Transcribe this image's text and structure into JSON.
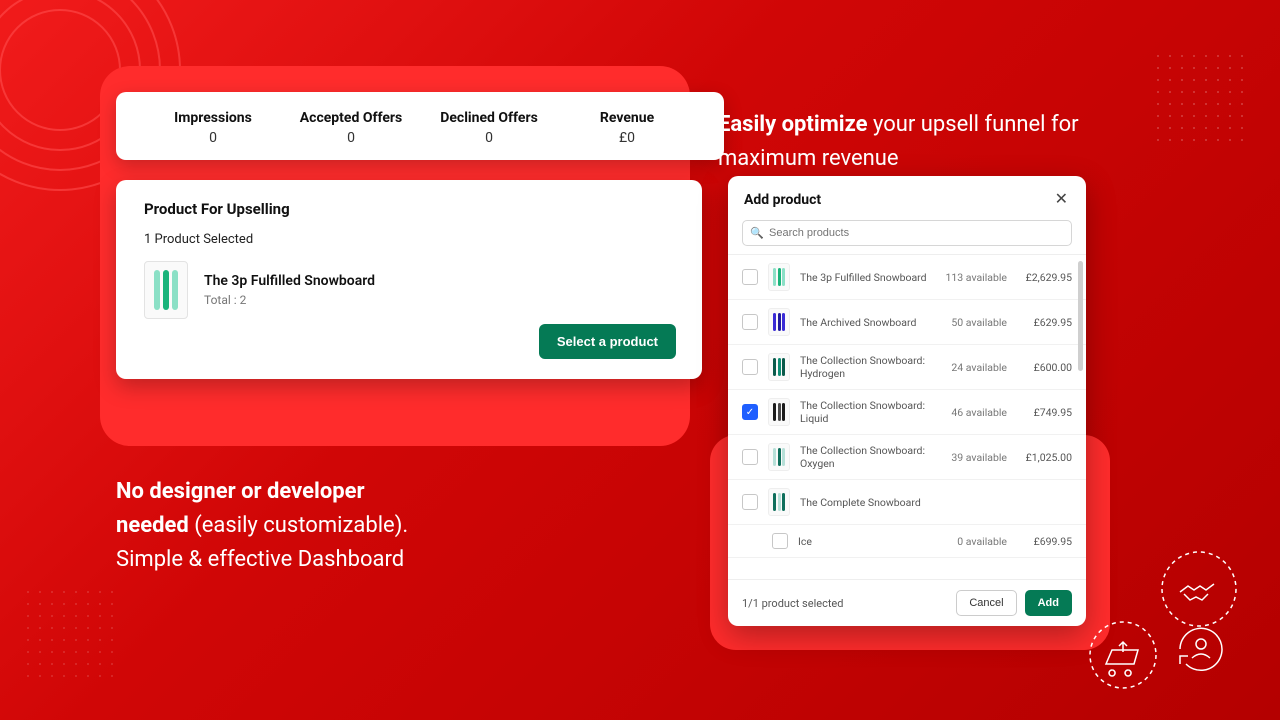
{
  "stats": {
    "impressions": {
      "label": "Impressions",
      "value": "0"
    },
    "accepted": {
      "label": "Accepted Offers",
      "value": "0"
    },
    "declined": {
      "label": "Declined Offers",
      "value": "0"
    },
    "revenue": {
      "label": "Revenue",
      "value": "£0"
    }
  },
  "upsell": {
    "heading": "Product For Upselling",
    "selected_summary": "1 Product Selected",
    "product": {
      "name": "The 3p Fulfilled Snowboard",
      "total": "Total : 2"
    },
    "select_button": "Select a product"
  },
  "left_caption": {
    "bold1": "No designer or developer",
    "bold2": "needed",
    "rest1": " (easily customizable).",
    "line2": "Simple & effective Dashboard"
  },
  "right_caption": {
    "bold": "Easily optimize",
    "rest": " your upsell funnel for maximum revenue"
  },
  "modal": {
    "title": "Add product",
    "search_placeholder": "Search products",
    "rows": [
      {
        "name": "The 3p Fulfilled Snowboard",
        "avail": "113 available",
        "price": "£2,629.95",
        "selected": false
      },
      {
        "name": "The Archived Snowboard",
        "avail": "50 available",
        "price": "£629.95",
        "selected": false
      },
      {
        "name": "The Collection Snowboard: Hydrogen",
        "avail": "24 available",
        "price": "£600.00",
        "selected": false
      },
      {
        "name": "The Collection Snowboard: Liquid",
        "avail": "46 available",
        "price": "£749.95",
        "selected": true
      },
      {
        "name": "The Collection Snowboard: Oxygen",
        "avail": "39 available",
        "price": "£1,025.00",
        "selected": false
      },
      {
        "name": "The Complete Snowboard",
        "avail": "",
        "price": "",
        "selected": false
      }
    ],
    "sub_row": {
      "name": "Ice",
      "avail": "0 available",
      "price": "£699.95"
    },
    "footer_count": "1/1 product selected",
    "cancel": "Cancel",
    "add": "Add"
  }
}
